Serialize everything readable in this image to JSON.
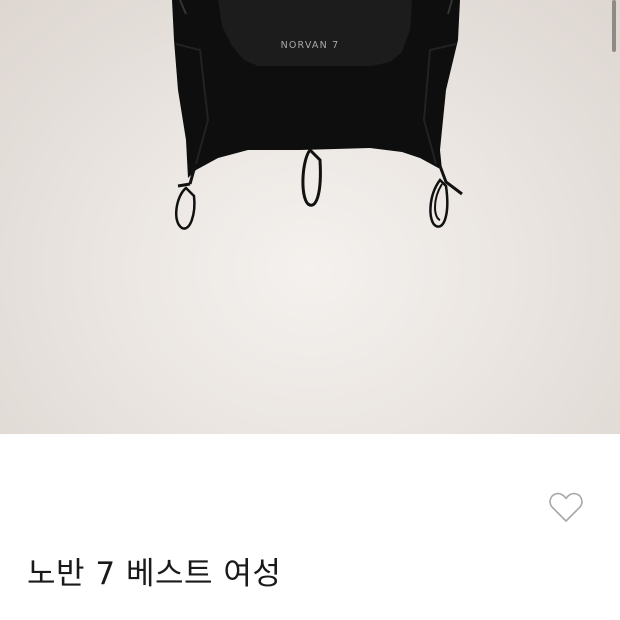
{
  "product": {
    "image_brand_text": "NORVAN 7",
    "title": "노반 7 베스트 여성"
  },
  "icons": {
    "wishlist": "heart-outline-icon"
  },
  "colors": {
    "hero_bg": "#ebe6e2",
    "vest": "#0d0d0d",
    "title": "#1a1a1a",
    "heart_outline": "#a8a8a8"
  }
}
